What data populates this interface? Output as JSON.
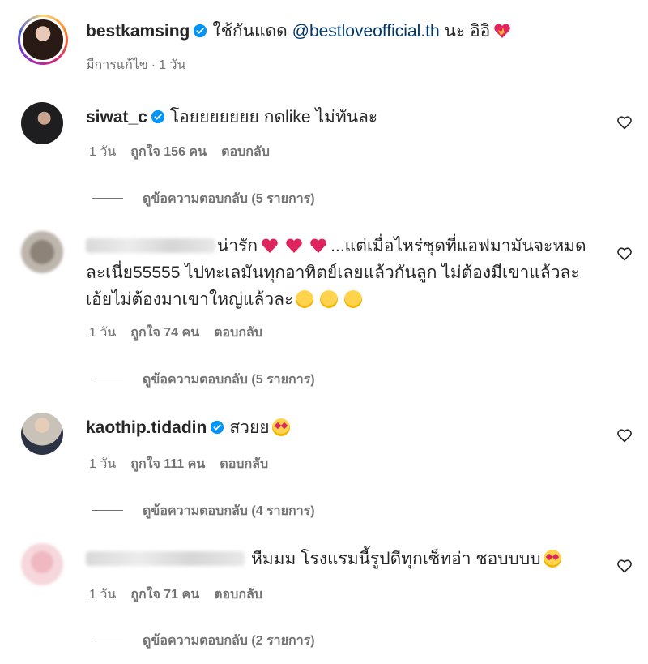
{
  "post": {
    "username": "bestkamsing",
    "caption_before": "ใช้กันแดด",
    "mention": "@bestloveofficial.th",
    "caption_after": "นะ อิอิ",
    "edited": "มีการแก้ไข",
    "time": "1 วัน"
  },
  "comments": [
    {
      "username": "siwat_c",
      "text": "โอยยยยยยย กดlike ไม่ทันละ",
      "time": "1 วัน",
      "likes": "ถูกใจ 156 คน",
      "reply": "ตอบกลับ",
      "view_replies": "ดูข้อความตอบกลับ (5 รายการ)"
    },
    {
      "username": "",
      "text_line1_a": "น่ารัก",
      "text_line1_b": "...แต่เมื่อไหร่ชุดที่แอฟมามันจะหมด",
      "text_line2": "ละเนี่ย55555 ไปทะเลมันทุกอาทิตย์เลยแล้วกันลูก ไม่ต้องมีเขาแล้วละ",
      "text_line3": "เอ้ยไม่ต้องมาเขาใหญ่แล้วละ",
      "time": "1 วัน",
      "likes": "ถูกใจ 74 คน",
      "reply": "ตอบกลับ",
      "view_replies": "ดูข้อความตอบกลับ (5 รายการ)"
    },
    {
      "username": "kaothip.tidadin",
      "text": "สวยย",
      "time": "1 วัน",
      "likes": "ถูกใจ 111 คน",
      "reply": "ตอบกลับ",
      "view_replies": "ดูข้อความตอบกลับ (4 รายการ)"
    },
    {
      "username": "",
      "text": "หืมมม โรงแรมนี้รูปดีทุกเซ็ทอ่า ชอบบบบ",
      "time": "1 วัน",
      "likes": "ถูกใจ 71 คน",
      "reply": "ตอบกลับ",
      "view_replies": "ดูข้อความตอบกลับ (2 รายการ)"
    }
  ],
  "colors": {
    "text": "#262626",
    "muted": "#737373",
    "mention": "#00376b",
    "verified": "#0095f6"
  },
  "icons": [
    "verified-badge-icon",
    "heart-outline-icon",
    "red-heart-emoji",
    "heart-eyes-emoji",
    "rofl-emoji",
    "heart-on-fire-emoji"
  ]
}
